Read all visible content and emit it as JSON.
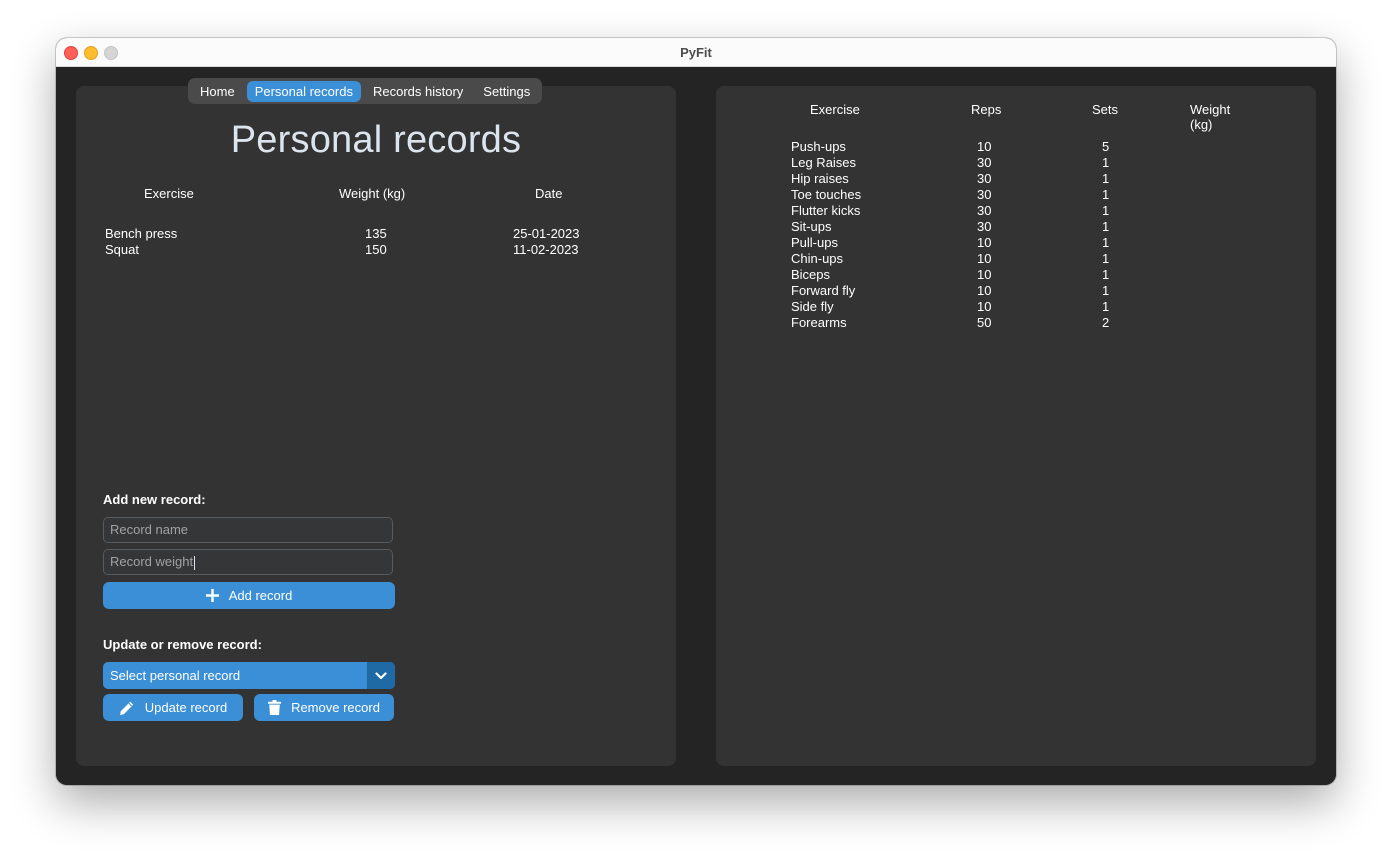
{
  "window": {
    "title": "PyFit"
  },
  "tabs": [
    {
      "label": "Home",
      "active": false
    },
    {
      "label": "Personal records",
      "active": true
    },
    {
      "label": "Records history",
      "active": false
    },
    {
      "label": "Settings",
      "active": false
    }
  ],
  "left": {
    "page_title": "Personal records",
    "records_table": {
      "headers": [
        "Exercise",
        "Weight (kg)",
        "Date"
      ],
      "rows": [
        [
          "Bench press",
          "135",
          "25-01-2023"
        ],
        [
          "Squat",
          "150",
          "11-02-2023"
        ]
      ]
    },
    "add_section_label": "Add new record:",
    "record_name_placeholder": "Record name",
    "record_weight_placeholder": "Record weight",
    "add_button_label": "Add record",
    "update_section_label": "Update or remove record:",
    "select_value": "Select personal record",
    "update_button_label": "Update record",
    "remove_button_label": "Remove record"
  },
  "right": {
    "exercises_table": {
      "headers": [
        "Exercise",
        "Reps",
        "Sets",
        "Weight (kg)"
      ],
      "rows": [
        [
          "Push-ups",
          "10",
          "5",
          ""
        ],
        [
          "Leg Raises",
          "30",
          "1",
          ""
        ],
        [
          "Hip raises",
          "30",
          "1",
          ""
        ],
        [
          "Toe touches",
          "30",
          "1",
          ""
        ],
        [
          "Flutter kicks",
          "30",
          "1",
          ""
        ],
        [
          "Sit-ups",
          "30",
          "1",
          ""
        ],
        [
          "Pull-ups",
          "10",
          "1",
          ""
        ],
        [
          "Chin-ups",
          "10",
          "1",
          ""
        ],
        [
          "Biceps",
          "10",
          "1",
          ""
        ],
        [
          "Forward fly",
          "10",
          "1",
          ""
        ],
        [
          "Side fly",
          "10",
          "1",
          ""
        ],
        [
          "Forearms",
          "50",
          "2",
          ""
        ]
      ]
    }
  },
  "colors": {
    "accent": "#3a8fd6",
    "accent_dark": "#1f6aa5",
    "panel": "#333333",
    "background": "#242424"
  },
  "icons": {
    "add": "plus-icon",
    "update": "pencil-icon",
    "remove": "trash-icon",
    "select": "chevron-down-icon"
  }
}
